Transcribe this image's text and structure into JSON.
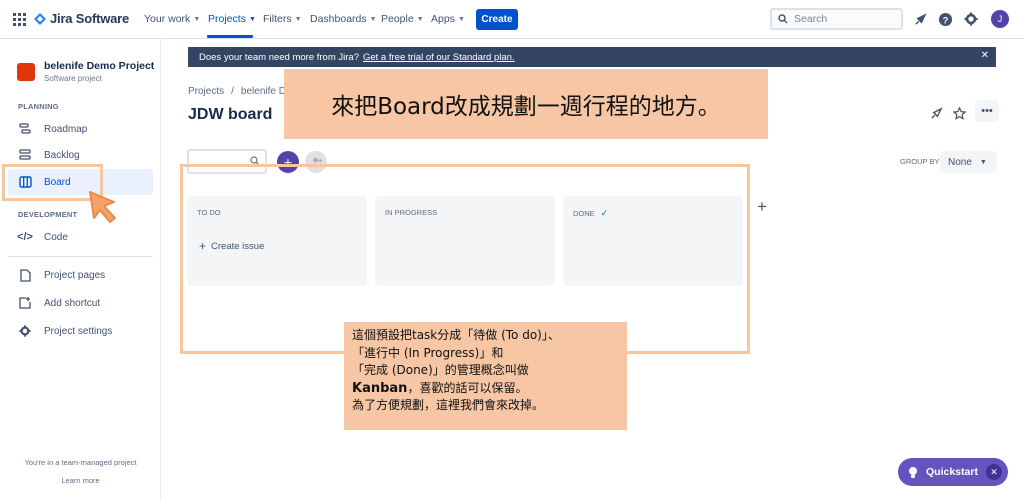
{
  "topnav": {
    "brand": "Jira Software",
    "items": [
      {
        "label": "Your work"
      },
      {
        "label": "Projects"
      },
      {
        "label": "Filters"
      },
      {
        "label": "Dashboards"
      },
      {
        "label": "People"
      },
      {
        "label": "Apps"
      }
    ],
    "create_label": "Create",
    "search_placeholder": "Search",
    "avatar_initial": "J"
  },
  "sidebar": {
    "project_name": "belenife Demo Project",
    "project_type": "Software project",
    "planning_label": "PLANNING",
    "development_label": "DEVELOPMENT",
    "items": [
      {
        "label": "Roadmap"
      },
      {
        "label": "Backlog"
      },
      {
        "label": "Board"
      },
      {
        "label": "Code"
      },
      {
        "label": "Project pages"
      },
      {
        "label": "Add shortcut"
      },
      {
        "label": "Project settings"
      }
    ],
    "footer_text": "You're in a team-managed project",
    "learn_more": "Learn more"
  },
  "banner": {
    "text": "Does your team need more from Jira?",
    "link": "Get a free trial of our Standard plan."
  },
  "main": {
    "breadcrumb": [
      "Projects",
      "/",
      "belenife De"
    ],
    "title": "JDW board",
    "group_by_label": "GROUP BY",
    "group_by_value": "None",
    "columns": [
      {
        "title": "TO DO"
      },
      {
        "title": "IN PROGRESS"
      },
      {
        "title": "DONE"
      }
    ],
    "create_issue": "Create issue"
  },
  "annotations": {
    "title": "來把Board改成規劃一週行程的地方。",
    "note_lines": [
      "這個預設把task分成「待做 (To do)」、",
      "「進行中 (In Progress)」和",
      "「完成 (Done)」的管理概念叫做",
      "Kanban，喜歡的話可以保留。",
      "為了方便規劃，這裡我們會來改掉。"
    ],
    "note_bold": "Kanban",
    "note_line4_rest": "，喜歡的話可以保留。"
  },
  "quickstart": {
    "label": "Quickstart"
  },
  "colors": {
    "primary": "#0052cc",
    "purple": "#6554c0",
    "highlight": "#f7c6a4",
    "banner": "#344563"
  }
}
